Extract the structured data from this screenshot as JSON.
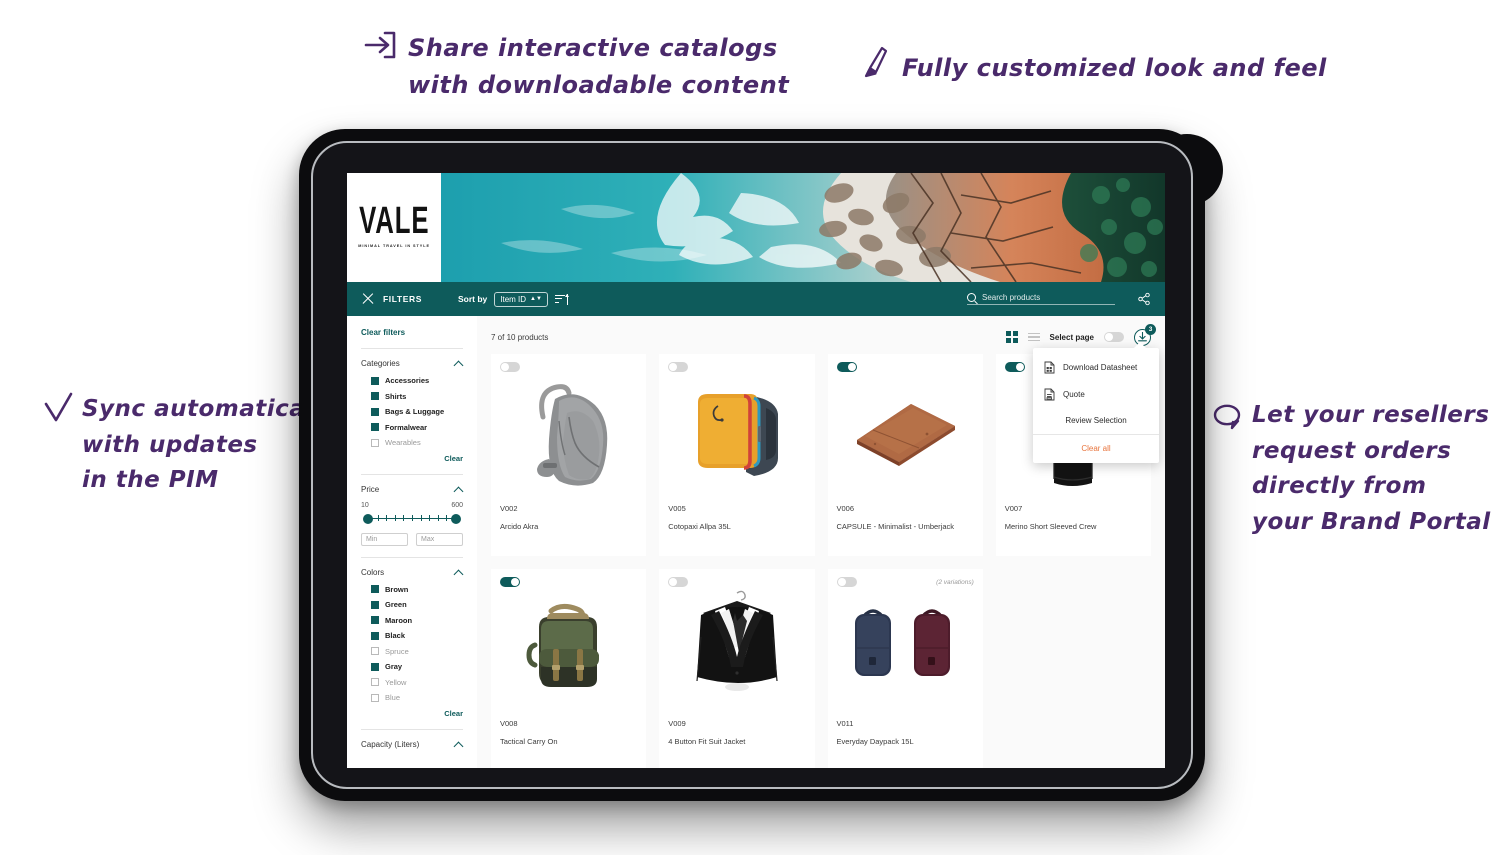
{
  "annotations": [
    {
      "id": "share",
      "icon": "share-arrow-icon",
      "text": "Share interactive catalogs\nwith downloadable content"
    },
    {
      "id": "custom",
      "icon": "paintbrush-icon",
      "text": "Fully customized look and feel"
    },
    {
      "id": "sync",
      "icon": "checkmark-icon",
      "text": "Sync automatically\nwith updates\nin the PIM"
    },
    {
      "id": "resell",
      "icon": "speech-bubble-icon",
      "text": "Let your resellers\nrequest orders\ndirectly from\nyour Brand Portal"
    }
  ],
  "brand": {
    "logo_word": "VALE",
    "logo_tagline": "MINIMAL TRAVEL IN STYLE"
  },
  "toolbar": {
    "filters_label": "FILTERS",
    "sort_by_label": "Sort by",
    "sort_value": "Item ID",
    "search_placeholder": "Search products",
    "share_icon": "share-nodes-icon"
  },
  "sidebar": {
    "clear_filters": "Clear filters",
    "clear_link": "Clear",
    "groups": [
      {
        "title": "Categories",
        "options": [
          {
            "label": "Accessories",
            "checked": true
          },
          {
            "label": "Shirts",
            "checked": true
          },
          {
            "label": "Bags & Luggage",
            "checked": true
          },
          {
            "label": "Formalwear",
            "checked": true
          },
          {
            "label": "Wearables",
            "checked": false
          }
        ]
      },
      {
        "title": "Colors",
        "options": [
          {
            "label": "Brown",
            "checked": true
          },
          {
            "label": "Green",
            "checked": true
          },
          {
            "label": "Maroon",
            "checked": true
          },
          {
            "label": "Black",
            "checked": true
          },
          {
            "label": "Spruce",
            "checked": false
          },
          {
            "label": "Gray",
            "checked": true
          },
          {
            "label": "Yellow",
            "checked": false
          },
          {
            "label": "Blue",
            "checked": false
          }
        ]
      }
    ],
    "price": {
      "title": "Price",
      "min": "10",
      "max": "600",
      "min_placeholder": "Min",
      "max_placeholder": "Max"
    },
    "capacity_title": "Capacity (Liters)"
  },
  "grid": {
    "count_label": "7 of 10 products",
    "select_page_label": "Select page",
    "select_page_on": false,
    "download_badge": "3"
  },
  "dropdown": {
    "items": [
      {
        "label": "Download Datasheet",
        "icon": "datasheet-document-icon"
      },
      {
        "label": "Quote",
        "icon": "quote-document-icon"
      }
    ],
    "review_label": "Review Selection",
    "clear_all_label": "Clear all",
    "clear_all_color": "#e8743c"
  },
  "products": [
    {
      "sku": "V002",
      "name": "Arcido Akra",
      "selected": false,
      "image": "gray-backpack",
      "variations": ""
    },
    {
      "sku": "V005",
      "name": "Cotopaxi Allpa 35L",
      "selected": false,
      "image": "yellow-duffel",
      "variations": ""
    },
    {
      "sku": "V006",
      "name": "CAPSULE - Minimalist - Umberjack",
      "selected": true,
      "image": "brown-wallet",
      "variations": ""
    },
    {
      "sku": "V007",
      "name": "Merino Short Sleeved Crew",
      "selected": true,
      "image": "black-tshirt",
      "variations": ""
    },
    {
      "sku": "V008",
      "name": "Tactical Carry On",
      "selected": true,
      "image": "green-rucksack",
      "variations": ""
    },
    {
      "sku": "V009",
      "name": "4 Button Fit Suit Jacket",
      "selected": false,
      "image": "black-suit",
      "variations": ""
    },
    {
      "sku": "V011",
      "name": "Everyday Daypack 15L",
      "selected": false,
      "image": "two-daypacks",
      "variations": "(2 variations)"
    }
  ],
  "colors": {
    "teal": "#0e5b5b",
    "annotation_purple": "#4a2a6b",
    "accent_orange": "#e8743c",
    "page_background": "#fafafa"
  }
}
